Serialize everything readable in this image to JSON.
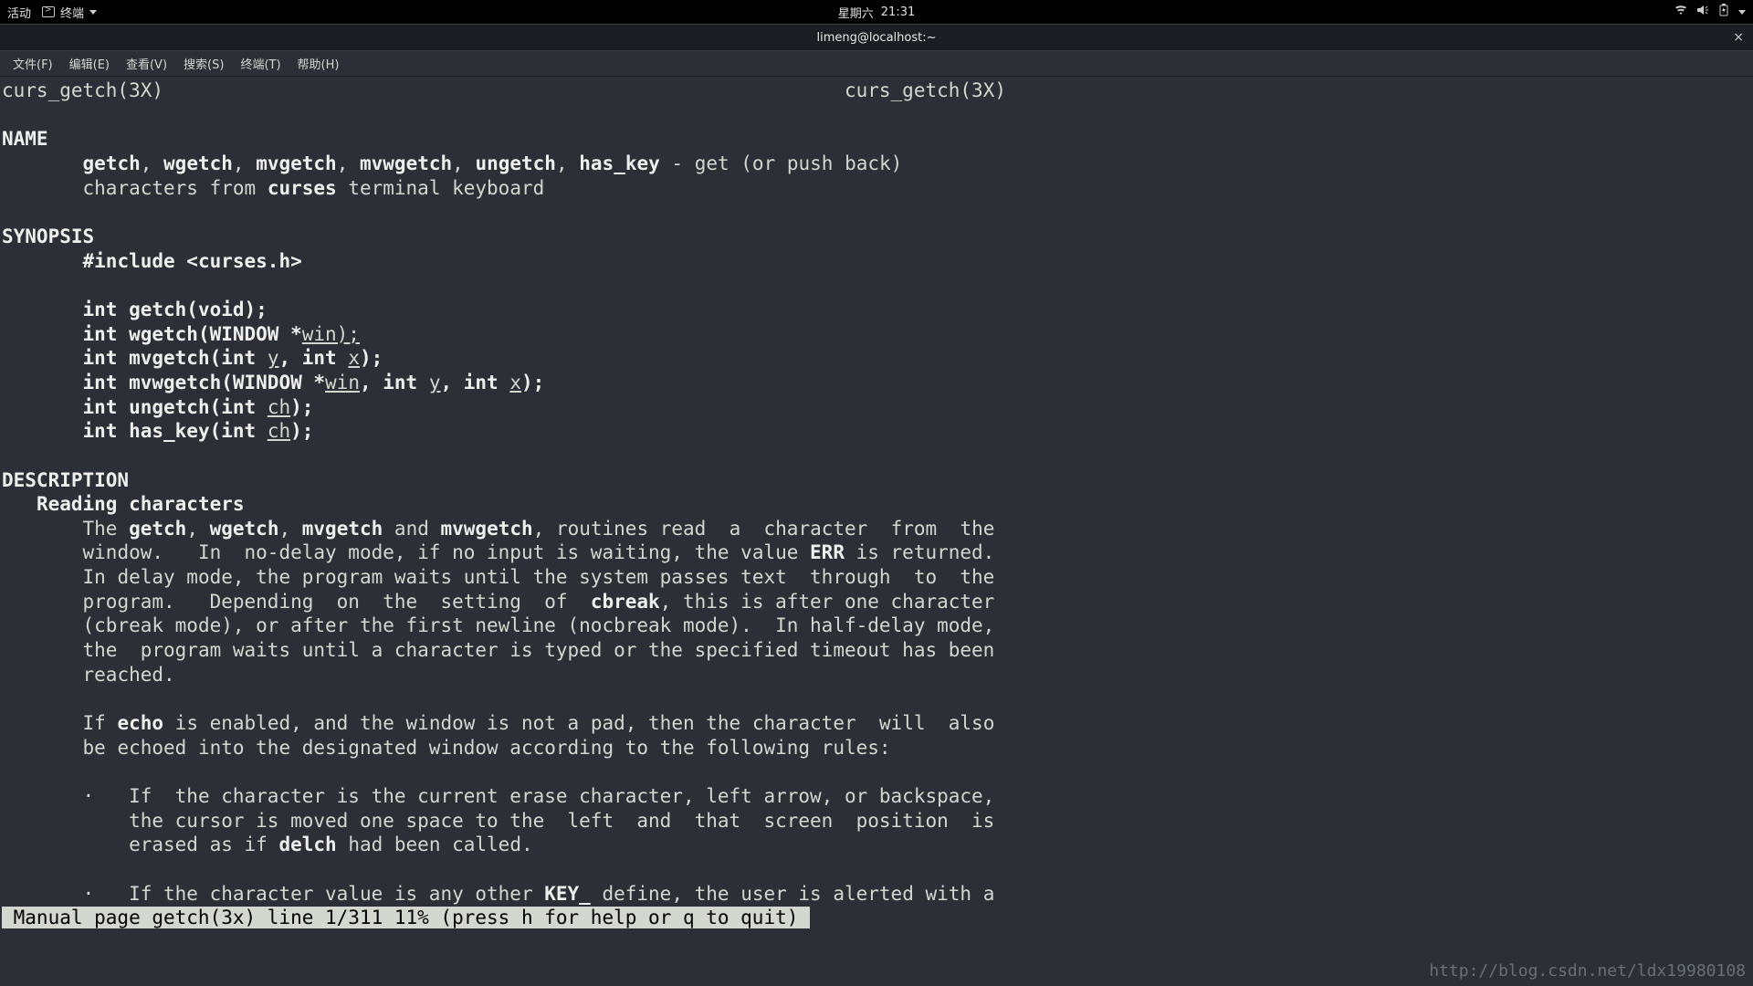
{
  "topbar": {
    "activities": "活动",
    "app_name": "终端",
    "date": "星期六",
    "time": "21:31"
  },
  "window": {
    "title": "limeng@localhost:~"
  },
  "menu": {
    "file": "文件(F)",
    "edit": "编辑(E)",
    "view": "查看(V)",
    "search": "搜索(S)",
    "terminal": "终端(T)",
    "help": "帮助(H)"
  },
  "man": {
    "header_left": "curs_getch(3X)",
    "header_right": "curs_getch(3X)",
    "sec_name": "NAME",
    "name_fns": [
      "getch",
      "wgetch",
      "mvgetch",
      "mvwgetch",
      "ungetch",
      "has_key"
    ],
    "name_desc1": " - get (or push back)",
    "name_desc2_pre": "characters from ",
    "name_desc2_b": "curses",
    "name_desc2_post": " terminal keyboard",
    "sec_syn": "SYNOPSIS",
    "include": "#include <curses.h>",
    "syn1": "int getch(void);",
    "syn2_a": "int wgetch(WINDOW *",
    "syn2_b": "win);",
    "syn3_a": "int mvgetch(int ",
    "syn3_y": "y",
    "syn3_c": ", int ",
    "syn3_x": "x",
    "syn3_e": ");",
    "syn4_a": "int mvwgetch(WINDOW *",
    "syn4_w": "win",
    "syn4_c1": ", int ",
    "syn4_y": "y",
    "syn4_c2": ", int ",
    "syn4_x": "x",
    "syn4_e": ");",
    "syn5_a": "int ungetch(int ",
    "syn5_ch": "ch",
    "syn5_e": ");",
    "syn6_a": "int has_key(int ",
    "syn6_ch": "ch",
    "syn6_e": ");",
    "sec_desc": "DESCRIPTION",
    "sub_read": "Reading characters",
    "p1_the": "The ",
    "p1_and": " and ",
    "p1_rest": ", routines read  a  character  from  the",
    "p2_a": "window.   In  no-delay mode, if no input is waiting, the value ",
    "p2_err": "ERR",
    "p2_b": " is returned.",
    "p3": "In delay mode, the program waits until the system passes text  through  to  the",
    "p4_a": "program.   Depending  on  the  setting  of  ",
    "p4_cb": "cbreak",
    "p4_b": ", this is after one character",
    "p5": "(cbreak mode), or after the first newline (nocbreak mode).  In half-delay mode,",
    "p6": "the  program waits until a character is typed or the specified timeout has been",
    "p7": "reached.",
    "p8_a": "If ",
    "p8_echo": "echo",
    "p8_b": " is enabled, and the window is not a pad, then the character  will  also",
    "p9": "be echoed into the designated window according to the following rules:",
    "b1_a": "·   If  the character is the current erase character, left arrow, or backspace,",
    "b1_b": "    the cursor is moved one space to the  left  and  that  screen  position  is",
    "b1_c1": "    erased as if ",
    "b1_delch": "delch",
    "b1_c2": " had been called.",
    "b2_a": "·   If the character value is any other ",
    "b2_key": "KEY_",
    "b2_b": " define, the user is alerted with a",
    "status": " Manual page getch(3x) line 1/311 11% (press h for help or q to quit) "
  },
  "watermark": "http://blog.csdn.net/ldx19980108"
}
